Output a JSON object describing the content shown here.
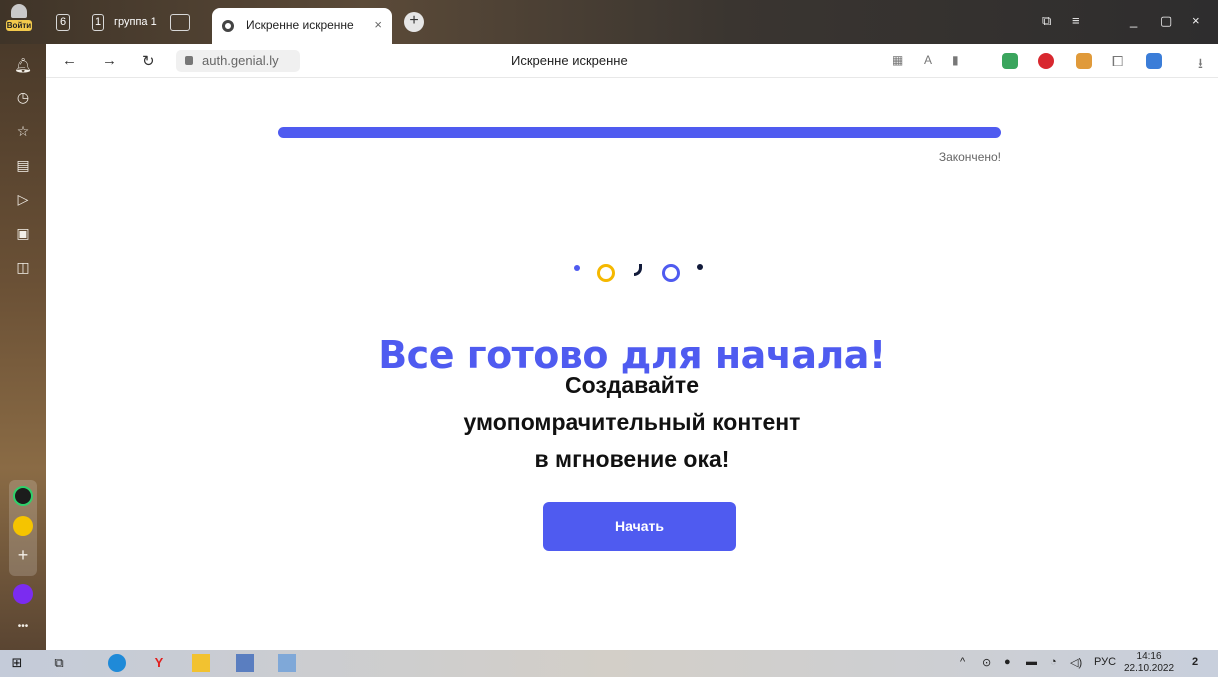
{
  "browser": {
    "login_label": "Войти",
    "tab_count": "6",
    "group": {
      "number": "1",
      "label": "группа 1"
    },
    "active_tab": {
      "title": "Искренне искренне",
      "close": "×"
    },
    "new_tab": "+",
    "window_controls": {
      "menu": "≡",
      "minimize": "_",
      "restore": "▢",
      "close": "×"
    }
  },
  "toolbar": {
    "url": "auth.genial.ly",
    "page_title": "Искренне искренне"
  },
  "page": {
    "progress_status": "Закончено!",
    "progress_fraction": 1.0,
    "headline": "Все готово для начала!",
    "subline_1": "Создавайте",
    "subline_2": "умопомрачительный контент",
    "subline_3": "в мгновение ока!",
    "start_button": "Начать",
    "accent_color": "#4f5bf0",
    "dot_colors": [
      "#4f5bf0",
      "#f5b800",
      "#111a3a",
      "#4f5bf0",
      "#111a3a"
    ]
  },
  "taskbar": {
    "language": "РУС",
    "time": "14:16",
    "date": "22.10.2022",
    "notifications": "2"
  }
}
